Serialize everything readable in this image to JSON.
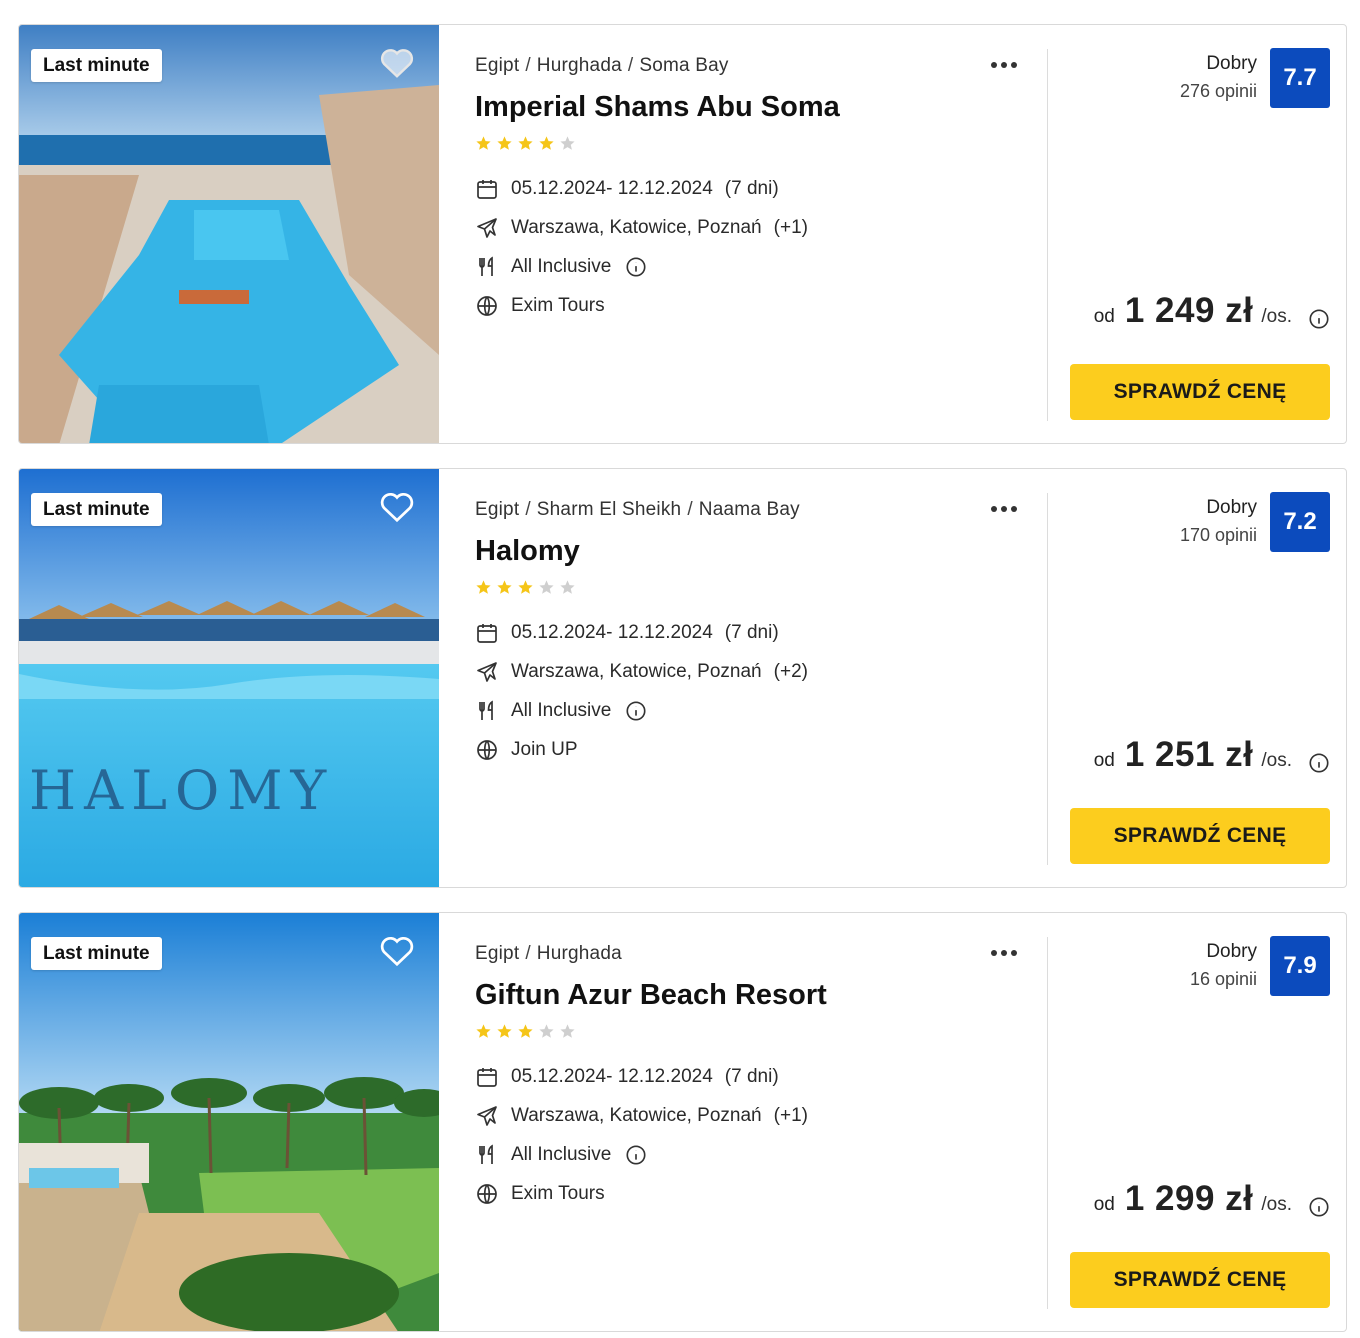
{
  "offers": [
    {
      "badge": "Last minute",
      "favorited": false,
      "breadcrumb": [
        "Egipt",
        "Hurghada",
        "Soma Bay"
      ],
      "name": "Imperial Shams Abu Soma",
      "stars": 4,
      "dates": "05.12.2024- 12.12.2024",
      "duration": "(7 dni)",
      "departures": "Warszawa, Katowice, Poznań",
      "departures_more": "(+1)",
      "board": "All Inclusive",
      "operator": "Exim Tours",
      "rating_label": "Dobry",
      "rating_count": "276 opinii",
      "score": "7.7",
      "price_prefix": "od",
      "price": "1 249 zł",
      "price_unit": "/os.",
      "cta": "SPRAWDŹ CENĘ"
    },
    {
      "badge": "Last minute",
      "favorited": false,
      "breadcrumb": [
        "Egipt",
        "Sharm El Sheikh",
        "Naama Bay"
      ],
      "name": "Halomy",
      "stars": 3,
      "dates": "05.12.2024- 12.12.2024",
      "duration": "(7 dni)",
      "departures": "Warszawa, Katowice, Poznań",
      "departures_more": "(+2)",
      "board": "All Inclusive",
      "operator": "Join UP",
      "rating_label": "Dobry",
      "rating_count": "170 opinii",
      "score": "7.2",
      "price_prefix": "od",
      "price": "1 251 zł",
      "price_unit": "/os.",
      "cta": "SPRAWDŹ CENĘ",
      "photo_text": "HALOMY"
    },
    {
      "badge": "Last minute",
      "favorited": false,
      "breadcrumb": [
        "Egipt",
        "Hurghada"
      ],
      "name": "Giftun Azur Beach Resort",
      "stars": 3,
      "dates": "05.12.2024- 12.12.2024",
      "duration": "(7 dni)",
      "departures": "Warszawa, Katowice, Poznań",
      "departures_more": "(+1)",
      "board": "All Inclusive",
      "operator": "Exim Tours",
      "rating_label": "Dobry",
      "rating_count": "16 opinii",
      "score": "7.9",
      "price_prefix": "od",
      "price": "1 299 zł",
      "price_unit": "/os.",
      "cta": "SPRAWDŹ CENĘ"
    }
  ],
  "icons": {
    "favorite": "heart-icon",
    "more": "more-dots-icon",
    "star": "star-icon",
    "dates": "calendar-icon",
    "departures": "plane-icon",
    "board": "cutlery-icon",
    "operator": "globe-icon",
    "info": "info-icon"
  },
  "colors": {
    "score_bg": "#0c4bbd",
    "cta_bg": "#fccd1e",
    "star_filled": "#f5c518",
    "star_empty": "#cfcfcf"
  }
}
